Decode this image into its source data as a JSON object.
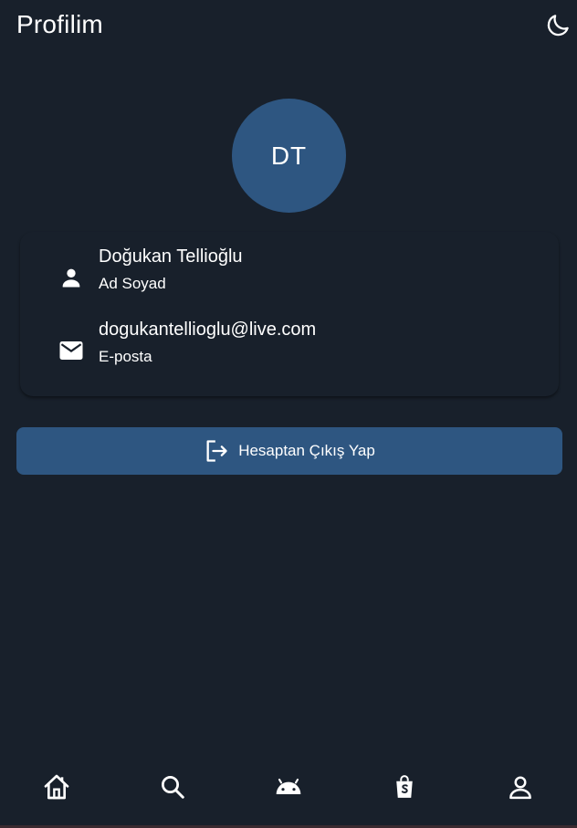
{
  "appbar": {
    "title": "Profilim",
    "theme_icon": "moon-icon"
  },
  "profile": {
    "initials": "DT",
    "name_value": "Doğukan Tellioğlu",
    "name_label": "Ad Soyad",
    "name_icon": "person-icon",
    "email_value": "dogukantellioglu@live.com",
    "email_label": "E-posta",
    "email_icon": "mail-icon"
  },
  "logout": {
    "label": "Hesaptan Çıkış Yap",
    "icon": "logout-icon"
  },
  "nav": {
    "items": [
      {
        "icon": "home-icon"
      },
      {
        "icon": "search-icon"
      },
      {
        "icon": "android-icon"
      },
      {
        "icon": "shopping-bag-icon"
      },
      {
        "icon": "user-icon"
      }
    ]
  },
  "colors": {
    "background": "#18202b",
    "accent": "#2e5681",
    "text": "#ffffff"
  }
}
